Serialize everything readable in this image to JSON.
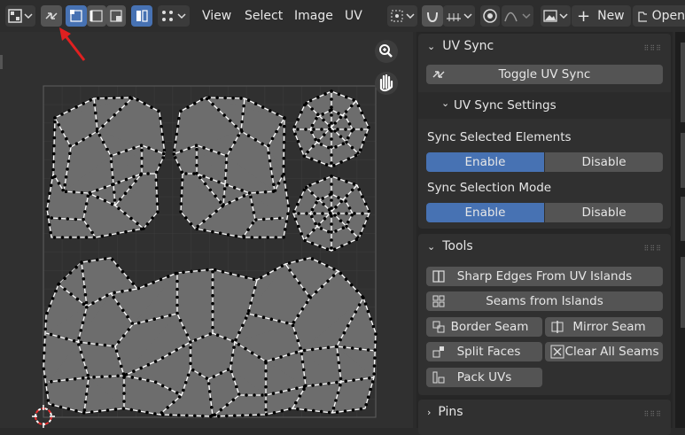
{
  "header": {
    "menus": [
      "View",
      "Select",
      "Image",
      "UV"
    ],
    "new_label": "New",
    "open_label": "Open"
  },
  "sidebar": {
    "uv_sync_panel": {
      "title": "UV Sync",
      "toggle_button": "Toggle UV Sync",
      "settings_title": "UV Sync Settings",
      "sync_selected_label": "Sync Selected Elements",
      "sync_mode_label": "Sync Selection Mode",
      "enable": "Enable",
      "disable": "Disable"
    },
    "tools_panel": {
      "title": "Tools",
      "sharp_edges": "Sharp Edges From UV Islands",
      "seams_from_islands": "Seams from Islands",
      "border_seam": "Border Seam",
      "mirror_seam": "Mirror Seam",
      "split_faces": "Split Faces",
      "clear_all_seams": "Clear All Seams",
      "pack_uvs": "Pack UVs"
    },
    "pins_panel": {
      "title": "Pins"
    }
  },
  "colors": {
    "accent": "#4772b3",
    "arrow": "#e02020",
    "uv_edge": "#ffffff",
    "uv_face": "#6a6a6a"
  },
  "icons": [
    "image-editor-icon",
    "uv-sync-icon",
    "select-mode-icons",
    "zoom-icon",
    "hand-icon",
    "cursor-icon"
  ]
}
